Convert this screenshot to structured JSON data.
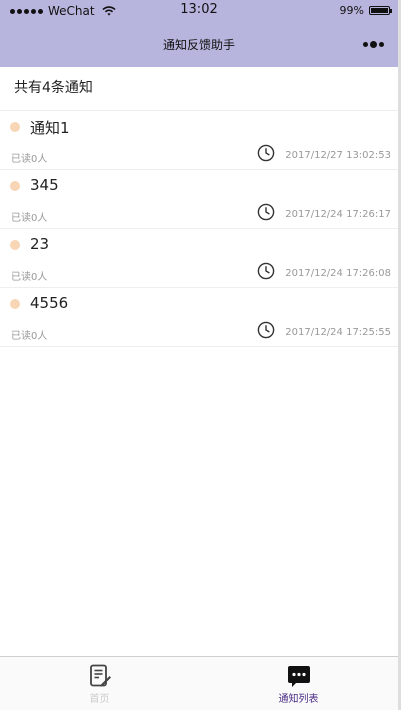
{
  "status_bar": {
    "carrier": "WeChat",
    "time": "13:02",
    "battery": "99%"
  },
  "nav": {
    "title": "通知反馈助手"
  },
  "summary": {
    "text": "共有4条通知"
  },
  "notices": [
    {
      "title": "通知1",
      "read": "已读0人",
      "time": "2017/12/27 13:02:53"
    },
    {
      "title": "345",
      "read": "已读0人",
      "time": "2017/12/24 17:26:17"
    },
    {
      "title": "23",
      "read": "已读0人",
      "time": "2017/12/24 17:26:08"
    },
    {
      "title": "4556",
      "read": "已读0人",
      "time": "2017/12/24 17:25:55"
    }
  ],
  "tabs": [
    {
      "label": "首页",
      "icon": "edit-note-icon",
      "active": false
    },
    {
      "label": "通知列表",
      "icon": "chat-bubble-icon",
      "active": true
    }
  ],
  "colors": {
    "nav_background": "#b7b5dd",
    "bullet": "#f7d5b5",
    "active_tab": "#4b2c84"
  }
}
